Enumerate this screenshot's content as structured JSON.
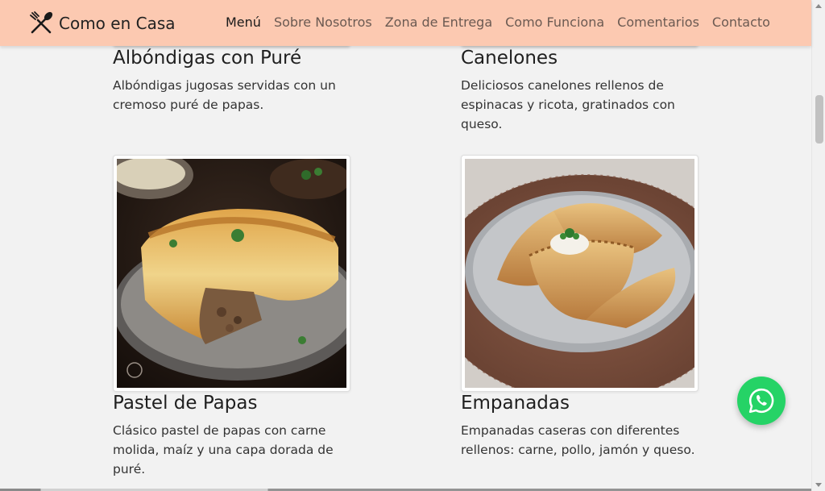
{
  "brand": {
    "name": "Como en Casa",
    "icon": "utensils-icon"
  },
  "nav": {
    "items": [
      {
        "label": "Menú",
        "active": true
      },
      {
        "label": "Sobre Nosotros",
        "active": false
      },
      {
        "label": "Zona de Entrega",
        "active": false
      },
      {
        "label": "Como Funciona",
        "active": false
      },
      {
        "label": "Comentarios",
        "active": false
      },
      {
        "label": "Contacto",
        "active": false
      }
    ]
  },
  "menu": {
    "items": [
      {
        "title": "Albóndigas con Puré",
        "description": "Albóndigas jugosas servidas con un cremoso puré de papas.",
        "image": "meatballs-image"
      },
      {
        "title": "Canelones",
        "description": "Deliciosos canelones rellenos de espinacas y ricota, gratinados con queso.",
        "image": "cannelloni-image"
      },
      {
        "title": "Pastel de Papas",
        "description": "Clásico pastel de papas con carne molida, maíz y una capa dorada de puré.",
        "image": "potato-pie-image"
      },
      {
        "title": "Empanadas",
        "description": "Empanadas caseras con diferentes rellenos: carne, pollo, jamón y queso.",
        "image": "empanadas-image"
      }
    ]
  },
  "floating": {
    "whatsapp_icon": "whatsapp-icon",
    "color": "#25d366"
  },
  "colors": {
    "navbar": "#fcc9b1",
    "background": "#f2f2f2"
  }
}
